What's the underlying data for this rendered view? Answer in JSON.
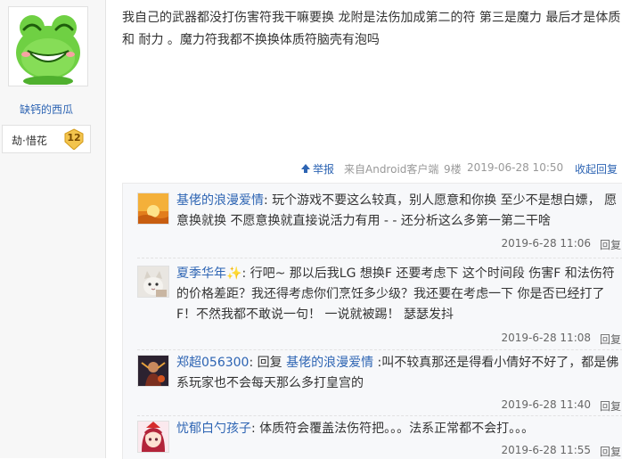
{
  "user": {
    "name": "缺钙的西瓜",
    "level_name": "劫·惜花",
    "level_num": "12",
    "avatar_icon": "green-frog-avatar"
  },
  "post": {
    "text": "我自己的武器都没打伤害符我干嘛要换 龙附是法伤加成第二的符 第三是魔力 最后才是体质和 耐力 。魔力符我都不换换体质符脑壳有泡吗",
    "report_label": "举报",
    "client": "来自Android客户端",
    "floor": "9楼",
    "date": "2019-06-28 10:50",
    "reply_toggle": "收起回复"
  },
  "comments": [
    {
      "user": "基佬的浪漫爱情",
      "sep": ": ",
      "text": "玩个游戏不要这么较真，别人愿意和你换 至少不是想白嫖， 愿意换就换 不愿意换就直接说活力有用 - - 还分析这么多第一第二干啥",
      "time": "2019-6-28 11:06",
      "reply": "回复",
      "avatar_icon": "sunset-avatar"
    },
    {
      "user": "夏季华年",
      "badge": "✨",
      "sep": ": ",
      "text": "行吧~ 那以后我LG 想换F 还要考虑下 这个时间段 伤害F 和法伤符的价格差距？我还得考虑你们烹饪多少级？我还要在考虑一下 你是否已经打了F！不然我都不敢说一句！ 一说就被踢！ 瑟瑟发抖",
      "time": "2019-6-28 11:08",
      "reply": "回复",
      "avatar_icon": "cat-avatar"
    },
    {
      "user": "郑超056300",
      "sep": ": ",
      "reply_prefix": "回复 ",
      "reply_target": "基佬的浪漫爱情",
      "text": " :叫不较真那还是得看小倩好不好了，都是佛系玩家也不会每天那么多打皇宫的",
      "time": "2019-6-28 11:40",
      "reply": "回复",
      "avatar_icon": "warrior-avatar"
    },
    {
      "user": "忧郁白勺孩子",
      "sep": ": ",
      "text": "体质符会覆盖法伤符把。。。法系正常都不会打。。。",
      "time": "2019-6-28 11:55",
      "reply": "回复",
      "avatar_icon": "anime-girl-avatar"
    }
  ],
  "colors": {
    "link": "#2d64b3",
    "meta": "#999999",
    "comment_bg": "#f7f8fa",
    "frog_green": "#5cc63c"
  }
}
